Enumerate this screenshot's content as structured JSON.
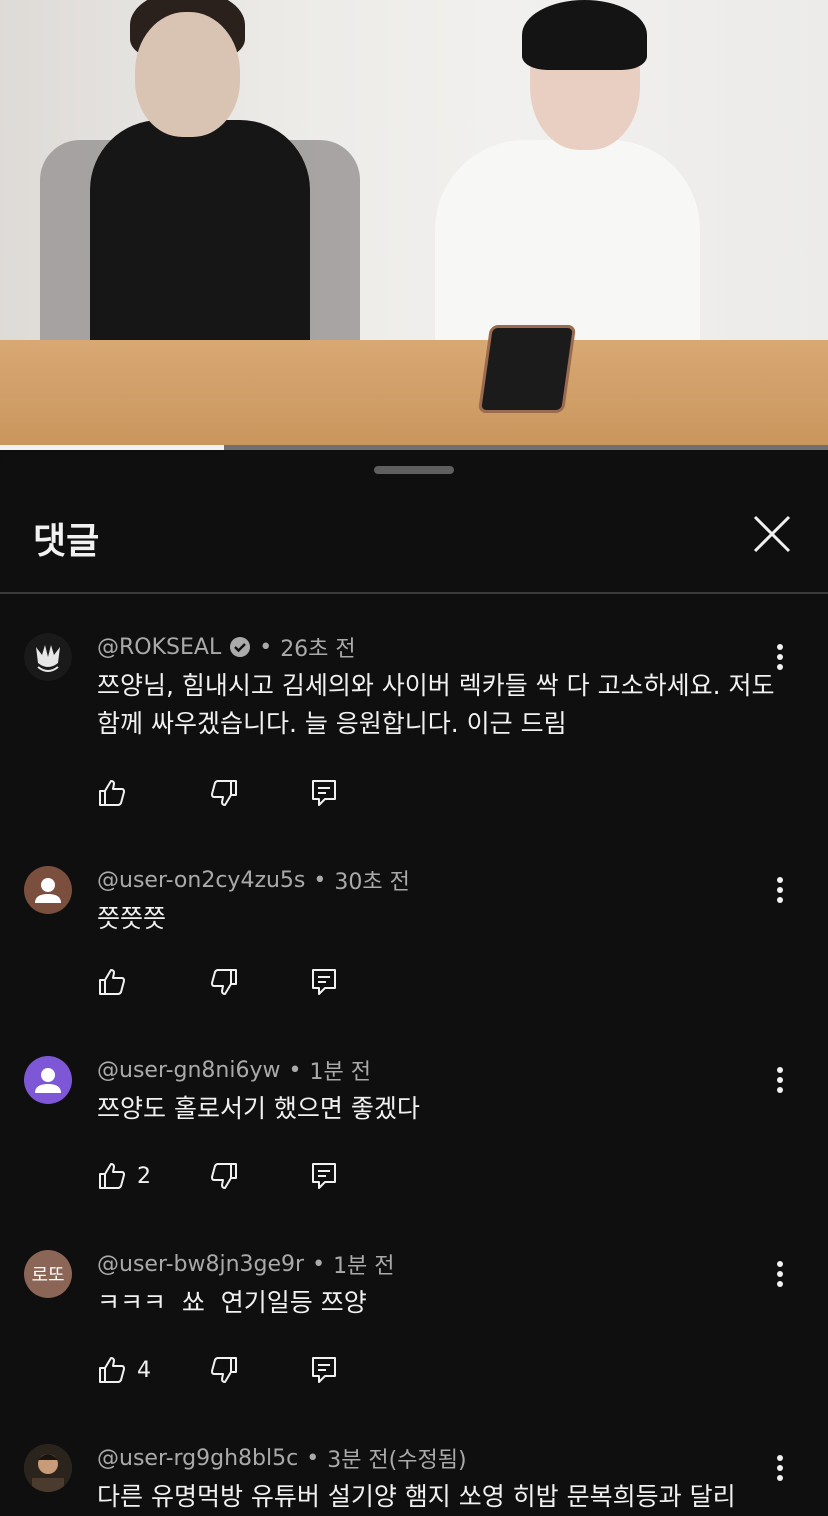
{
  "video": {
    "progress_fraction": 0.27
  },
  "panel": {
    "title": "댓글"
  },
  "comments": [
    {
      "author": "@ROKSEAL",
      "verified": true,
      "time": "26초 전",
      "text": "쯔양님, 힘내시고 김세의와 사이버 렉카들 싹 다 고소하세요. 저도 함께 싸우겠습니다. 늘 응원합니다. 이근 드림",
      "likes": "",
      "avatar_type": "emblem-icon"
    },
    {
      "author": "@user-on2cy4zu5s",
      "verified": false,
      "time": "30초 전",
      "text": "쯧쯧쯧",
      "likes": "",
      "avatar_type": "default-user-icon",
      "avatar_color": "#7b4f3e"
    },
    {
      "author": "@user-gn8ni6yw",
      "verified": false,
      "time": "1분 전",
      "text": "쯔양도 홀로서기 했으면 좋겠다",
      "likes": "2",
      "avatar_type": "default-user-icon",
      "avatar_color": "#7d57d6"
    },
    {
      "author": "@user-bw8jn3ge9r",
      "verified": false,
      "time": "1분 전",
      "text": "ㅋㅋㅋ  쑈  연기일등 쯔양",
      "likes": "4",
      "avatar_type": "initials",
      "avatar_initials": "로또",
      "avatar_color": "#8b6556"
    },
    {
      "author": "@user-rg9gh8bl5c",
      "verified": false,
      "time": "3분 전(수정됨)",
      "text": "다른 유명먹방 유튜버 설기양 햄지 쏘영 히밥 문복희등과 달리",
      "likes": "",
      "avatar_type": "photo"
    }
  ]
}
